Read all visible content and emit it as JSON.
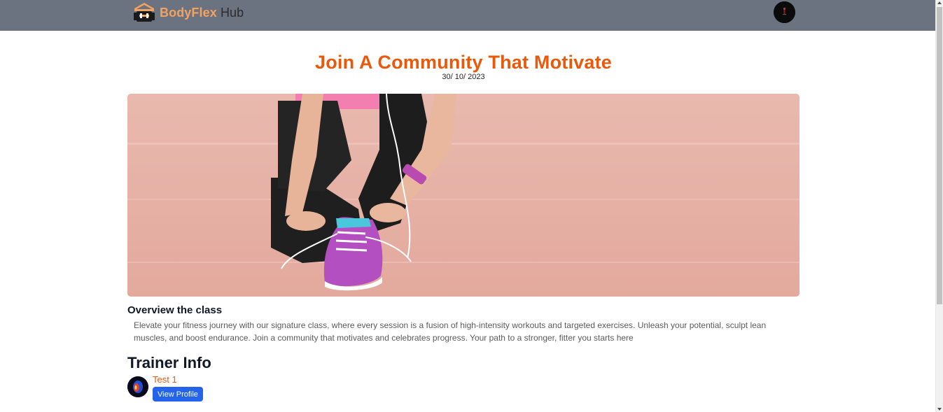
{
  "navbar": {
    "brand_primary": "BodyFlex",
    "brand_secondary": "Hub",
    "logo_icon": "dumbbell-house-logo",
    "avatar_icon": "user-avatar",
    "bg_color": "#6b7280",
    "brand_color": "#f4a261"
  },
  "page": {
    "title": "Join A Community That Motivate",
    "date": "30/ 10/ 2023",
    "title_color": "#e8590c"
  },
  "hero": {
    "image": "woman-tying-running-shoe-photo"
  },
  "overview": {
    "heading": "Overview the class",
    "text": "Elevate your fitness journey with our signature class, where every session is a fusion of high-intensity workouts and targeted exercises. Unleash your potential, sculpt lean muscles, and boost endurance. Join a community that motivates and celebrates progress. Your path to a stronger, fitter you starts here"
  },
  "trainer": {
    "heading": "Trainer Info",
    "name": "Test 1",
    "button_label": "View Profile",
    "avatar_icon": "trainer-avatar",
    "button_color": "#2563eb"
  }
}
